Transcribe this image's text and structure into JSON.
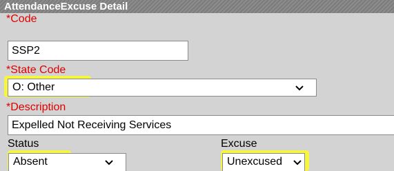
{
  "panel": {
    "title": "AttendanceExcuse Detail"
  },
  "fields": {
    "code": {
      "required_mark": "*",
      "label": "Code",
      "value": "SSP2"
    },
    "state_code": {
      "required_mark": "*",
      "label": "State Code",
      "selected": "O: Other"
    },
    "description": {
      "required_mark": "*",
      "label": "Description",
      "value": "Expelled Not Receiving Services"
    },
    "status": {
      "label": "Status",
      "selected": "Absent"
    },
    "excuse": {
      "label": "Excuse",
      "selected": "Unexcused"
    }
  },
  "icons": {
    "dropdown": "chevron-down-icon"
  },
  "colors": {
    "required": "#e00000",
    "highlight": "#f5f542",
    "header_bg": "#858585"
  }
}
